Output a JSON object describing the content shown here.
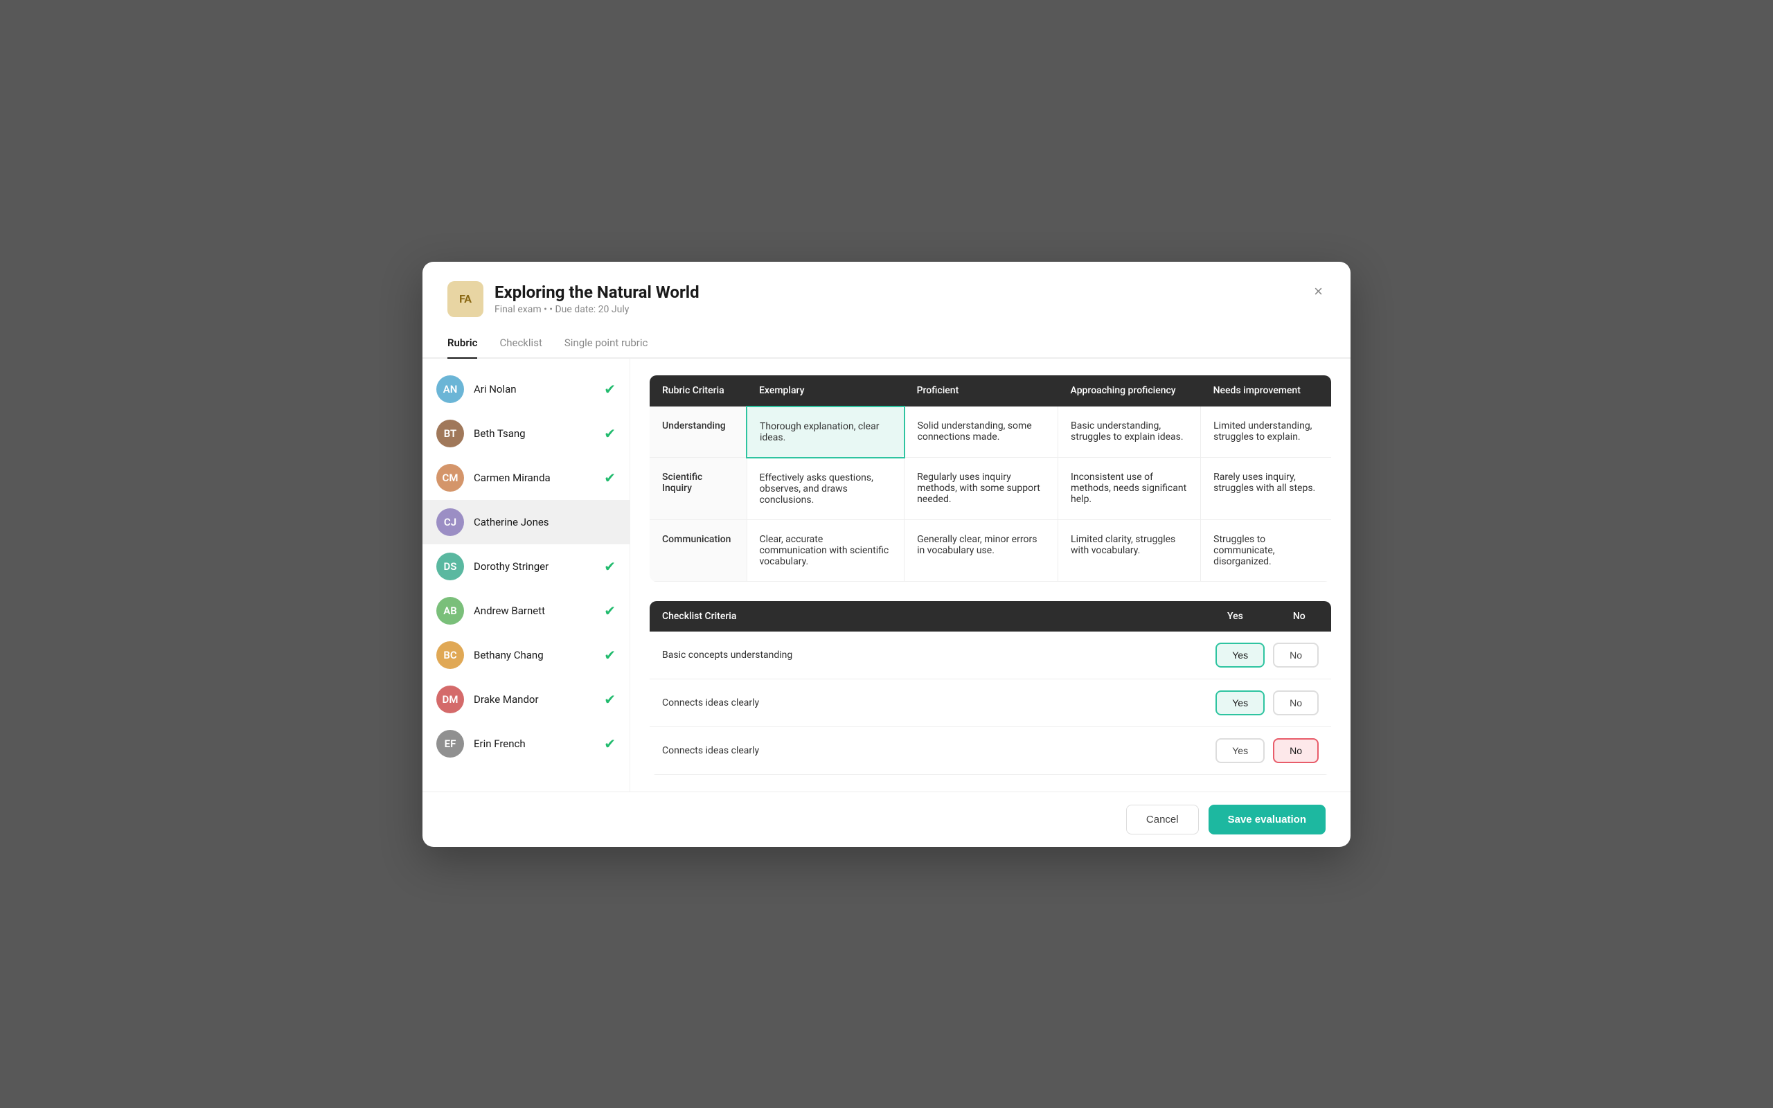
{
  "modal": {
    "avatar_label": "FA",
    "title": "Exploring the Natural World",
    "subtitle": "Final exam • • Due date: 20 July",
    "close_label": "×"
  },
  "tabs": [
    {
      "label": "Rubric",
      "active": true
    },
    {
      "label": "Checklist",
      "active": false
    },
    {
      "label": "Single point rubric",
      "active": false
    }
  ],
  "students": [
    {
      "name": "Ari Nolan",
      "checked": true,
      "active": false,
      "av_class": "av-blue"
    },
    {
      "name": "Beth Tsang",
      "checked": true,
      "active": false,
      "av_class": "av-brown"
    },
    {
      "name": "Carmen Miranda",
      "checked": true,
      "active": false,
      "av_class": "av-peach"
    },
    {
      "name": "Catherine Jones",
      "checked": false,
      "active": true,
      "av_class": "av-purple"
    },
    {
      "name": "Dorothy Stringer",
      "checked": true,
      "active": false,
      "av_class": "av-teal"
    },
    {
      "name": "Andrew Barnett",
      "checked": true,
      "active": false,
      "av_class": "av-green"
    },
    {
      "name": "Bethany Chang",
      "checked": true,
      "active": false,
      "av_class": "av-orange"
    },
    {
      "name": "Drake Mandor",
      "checked": true,
      "active": false,
      "av_class": "av-red"
    },
    {
      "name": "Erin French",
      "checked": true,
      "active": false,
      "av_class": "av-gray"
    }
  ],
  "rubric": {
    "headers": [
      "Rubric Criteria",
      "Exemplary",
      "Proficient",
      "Approaching proficiency",
      "Needs improvement"
    ],
    "rows": [
      {
        "criteria": "Understanding",
        "exemplary": "Thorough explanation, clear ideas.",
        "proficient": "Solid understanding, some connections made.",
        "approaching": "Basic understanding, struggles to explain ideas.",
        "needs_improvement": "Limited understanding, struggles to explain.",
        "selected": "exemplary"
      },
      {
        "criteria": "Scientific Inquiry",
        "exemplary": "Effectively asks questions, observes, and draws conclusions.",
        "proficient": "Regularly uses inquiry methods, with some support needed.",
        "approaching": "Inconsistent use of methods, needs significant help.",
        "needs_improvement": "Rarely uses inquiry, struggles with all steps.",
        "selected": "none"
      },
      {
        "criteria": "Communication",
        "exemplary": "Clear, accurate communication with scientific vocabulary.",
        "proficient": "Generally clear, minor errors in vocabulary use.",
        "approaching": "Limited clarity, struggles with vocabulary.",
        "needs_improvement": "Struggles to communicate, disorganized.",
        "selected": "none"
      }
    ]
  },
  "checklist": {
    "headers": [
      "Checklist Criteria",
      "Yes",
      "No"
    ],
    "rows": [
      {
        "criteria": "Basic concepts understanding",
        "selected": "yes"
      },
      {
        "criteria": "Connects ideas clearly",
        "selected": "yes"
      },
      {
        "criteria": "Connects ideas clearly",
        "selected": "no"
      }
    ]
  },
  "footer": {
    "cancel_label": "Cancel",
    "save_label": "Save evaluation"
  }
}
